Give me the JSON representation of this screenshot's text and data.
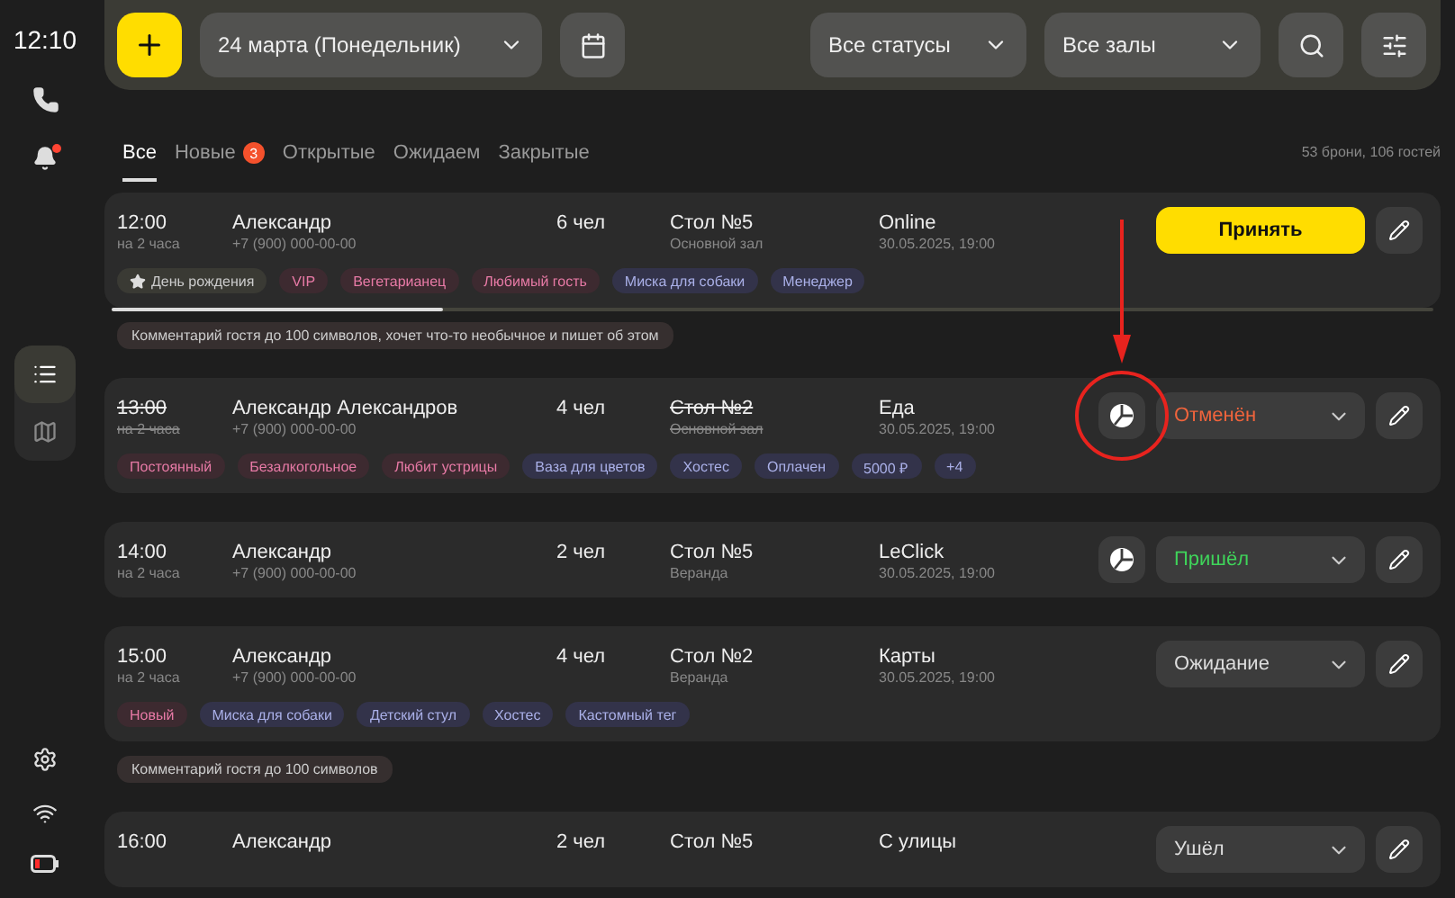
{
  "sidebar": {
    "time": "12:10",
    "nav": [
      {
        "kind": "list",
        "selected": true
      },
      {
        "kind": "map",
        "selected": false
      }
    ],
    "battery_low": true,
    "notifications": true
  },
  "toolbar": {
    "date": "24 марта (Понедельник)",
    "status_filter": "Все статусы",
    "hall_filter": "Все залы"
  },
  "tabs": [
    {
      "label": "Все",
      "selected": true
    },
    {
      "label": "Новые",
      "badge": "3",
      "selected": false
    },
    {
      "label": "Открытые",
      "selected": false
    },
    {
      "label": "Ожидаем",
      "selected": false
    },
    {
      "label": "Закрытые",
      "selected": false
    }
  ],
  "summary": "53 брони, 106 гостей",
  "reservations": [
    {
      "time": "12:00",
      "duration": "на 2 часа",
      "name": "Александр",
      "phone": "+7 (900) 000-00-00",
      "guests": "6 чел",
      "table": "Стол №5",
      "hall": "Основной зал",
      "source": "Online",
      "created": "30.05.2025, 19:00",
      "cancelled": false,
      "action": {
        "kind": "accept",
        "label": "Принять"
      },
      "level": 0.25,
      "tags": [
        {
          "label": "День рождения",
          "kind": "event"
        },
        {
          "label": "VIP",
          "kind": "guest"
        },
        {
          "label": "Вегетарианец",
          "kind": "guest"
        },
        {
          "label": "Любимый гость",
          "kind": "guest"
        },
        {
          "label": "Миска для собаки",
          "kind": "service"
        },
        {
          "label": "Менеджер",
          "kind": "service"
        }
      ],
      "comment": "Комментарий гостя до 100 символов, хочет что-то необычное и пишет об этом"
    },
    {
      "time": "13:00",
      "duration": "на 2 часа",
      "name": "Александр Александров",
      "phone": "+7 (900) 000-00-00",
      "guests": "4 чел",
      "table": "Стол №2",
      "hall": "Основной зал",
      "source": "Еда",
      "created": "30.05.2025, 19:00",
      "cancelled": true,
      "chart_button": true,
      "highlighted": true,
      "action": {
        "kind": "cancelled",
        "label": "Отменён"
      },
      "tags": [
        {
          "label": "Постоянный",
          "kind": "guest"
        },
        {
          "label": "Безалкогольное",
          "kind": "guest"
        },
        {
          "label": "Любит устрицы",
          "kind": "guest"
        },
        {
          "label": "Ваза для цветов",
          "kind": "service"
        },
        {
          "label": "Хостес",
          "kind": "service"
        },
        {
          "label": "Оплачен",
          "kind": "service"
        },
        {
          "label": "5000 ₽",
          "kind": "service"
        },
        {
          "label": "+4",
          "kind": "service"
        }
      ]
    },
    {
      "time": "14:00",
      "duration": "на 2 часа",
      "name": "Александр",
      "phone": "+7 (900) 000-00-00",
      "guests": "2 чел",
      "table": "Стол №5",
      "hall": "Веранда",
      "source": "LeClick",
      "created": "30.05.2025, 19:00",
      "cancelled": false,
      "chart_button": true,
      "action": {
        "kind": "arrived",
        "label": "Пришёл"
      }
    },
    {
      "time": "15:00",
      "duration": "на 2 часа",
      "name": "Александр",
      "phone": "+7 (900) 000-00-00",
      "guests": "4 чел",
      "table": "Стол №2",
      "hall": "Веранда",
      "source": "Карты",
      "created": "30.05.2025, 19:00",
      "cancelled": false,
      "action": {
        "kind": "waiting",
        "label": "Ожидание"
      },
      "tags": [
        {
          "label": "Новый",
          "kind": "guest"
        },
        {
          "label": "Миска для собаки",
          "kind": "service"
        },
        {
          "label": "Детский стул",
          "kind": "service"
        },
        {
          "label": "Хостес",
          "kind": "service"
        },
        {
          "label": "Кастомный тег",
          "kind": "service"
        }
      ],
      "comment": "Комментарий гостя до 100 символов"
    },
    {
      "time": "16:00",
      "name": "Александр",
      "guests": "2 чел",
      "table": "Стол №5",
      "source": "С улицы",
      "cancelled": false,
      "action": {
        "kind": "left",
        "label": "Ушёл"
      }
    }
  ]
}
